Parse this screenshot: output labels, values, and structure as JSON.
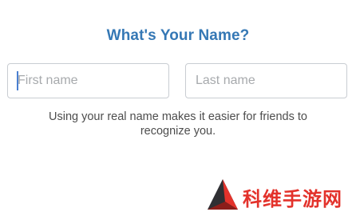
{
  "header": {
    "title": "What's Your Name?"
  },
  "form": {
    "first_name": {
      "value": "",
      "placeholder": "First name"
    },
    "last_name": {
      "value": "",
      "placeholder": "Last name"
    },
    "helper_text": "Using your real name makes it easier for friends to recognize you."
  },
  "watermark": {
    "text": "科维手游网",
    "icon": "triangle-logo-icon"
  },
  "colors": {
    "title": "#3578b5",
    "caret": "#4a7fd0",
    "watermark_red": "#e3322b",
    "watermark_dark": "#2f2f33"
  }
}
